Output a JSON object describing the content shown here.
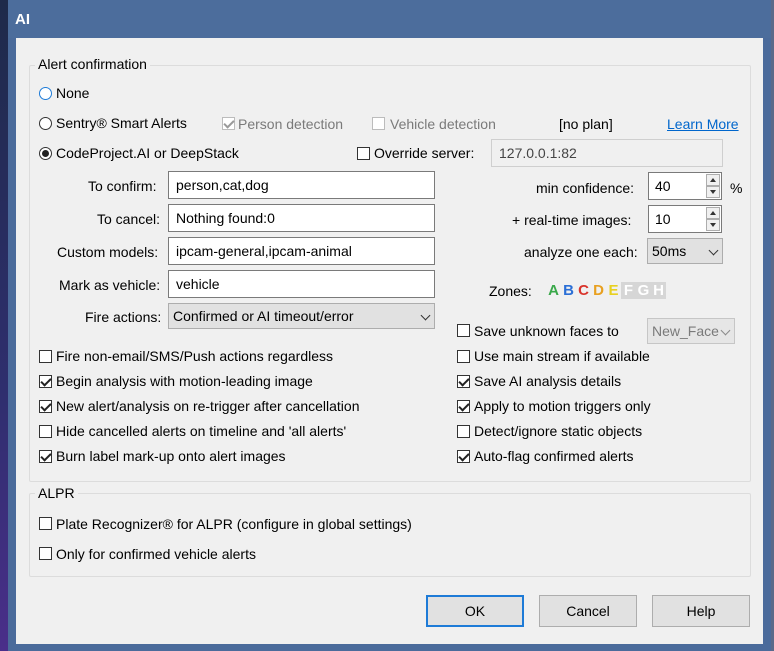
{
  "window": {
    "title": "AI"
  },
  "alert_group": {
    "label": "Alert confirmation"
  },
  "mode": {
    "none_label": "None",
    "sentry_label": "Sentry® Smart Alerts",
    "codeproject_label": "CodeProject.AI or DeepStack",
    "selected": "codeproject"
  },
  "sentry": {
    "person_label": "Person detection",
    "person_checked": true,
    "vehicle_label": "Vehicle detection",
    "vehicle_checked": false,
    "plan_text": "[no plan]",
    "learn_more": "Learn More"
  },
  "override": {
    "label": "Override server:",
    "checked": false,
    "value": "127.0.0.1:82"
  },
  "fields": {
    "to_confirm_label": "To confirm:",
    "to_confirm_value": "person,cat,dog",
    "to_cancel_label": "To cancel:",
    "to_cancel_value": "Nothing found:0",
    "custom_models_label": "Custom models:",
    "custom_models_value": "ipcam-general,ipcam-animal",
    "mark_vehicle_label": "Mark as vehicle:",
    "mark_vehicle_value": "vehicle",
    "fire_actions_label": "Fire actions:",
    "fire_actions_value": "Confirmed or AI timeout/error"
  },
  "right_fields": {
    "min_conf_label": "min confidence:",
    "min_conf_value": "40",
    "min_conf_unit": "%",
    "realtime_label": "+ real-time images:",
    "realtime_value": "10",
    "analyze_label": "analyze one each:",
    "analyze_value": "50ms",
    "zones_label": "Zones:"
  },
  "zones": [
    {
      "letter": "A",
      "color": "#3aa84a",
      "enabled": true
    },
    {
      "letter": "B",
      "color": "#2b6fd6",
      "enabled": true
    },
    {
      "letter": "C",
      "color": "#d9342b",
      "enabled": true
    },
    {
      "letter": "D",
      "color": "#e8a020",
      "enabled": true
    },
    {
      "letter": "E",
      "color": "#e8d020",
      "enabled": true
    },
    {
      "letter": "F",
      "color": "#ffffff",
      "enabled": false
    },
    {
      "letter": "G",
      "color": "#ffffff",
      "enabled": false
    },
    {
      "letter": "H",
      "color": "#ffffff",
      "enabled": false
    }
  ],
  "faces": {
    "label": "Save unknown faces to",
    "checked": false,
    "value": "New_Face"
  },
  "left_checks": [
    {
      "label": "Fire non-email/SMS/Push actions regardless",
      "checked": false
    },
    {
      "label": "Begin analysis with motion-leading image",
      "checked": true
    },
    {
      "label": "New alert/analysis on re-trigger after cancellation",
      "checked": true
    },
    {
      "label": "Hide cancelled alerts on timeline and  'all alerts'",
      "checked": false
    },
    {
      "label": "Burn label mark-up onto alert images",
      "checked": true
    }
  ],
  "right_checks": [
    {
      "label": "Use main stream if available",
      "checked": false
    },
    {
      "label": "Save AI analysis details",
      "checked": true
    },
    {
      "label": "Apply to motion triggers only",
      "checked": true
    },
    {
      "label": "Detect/ignore static objects",
      "checked": false
    },
    {
      "label": "Auto-flag confirmed alerts",
      "checked": true
    }
  ],
  "alpr": {
    "label": "ALPR",
    "plate_label": "Plate Recognizer® for ALPR (configure in global settings)",
    "plate_checked": false,
    "vehicle_only_label": "Only for confirmed vehicle alerts",
    "vehicle_only_checked": false
  },
  "buttons": {
    "ok": "OK",
    "cancel": "Cancel",
    "help": "Help"
  }
}
